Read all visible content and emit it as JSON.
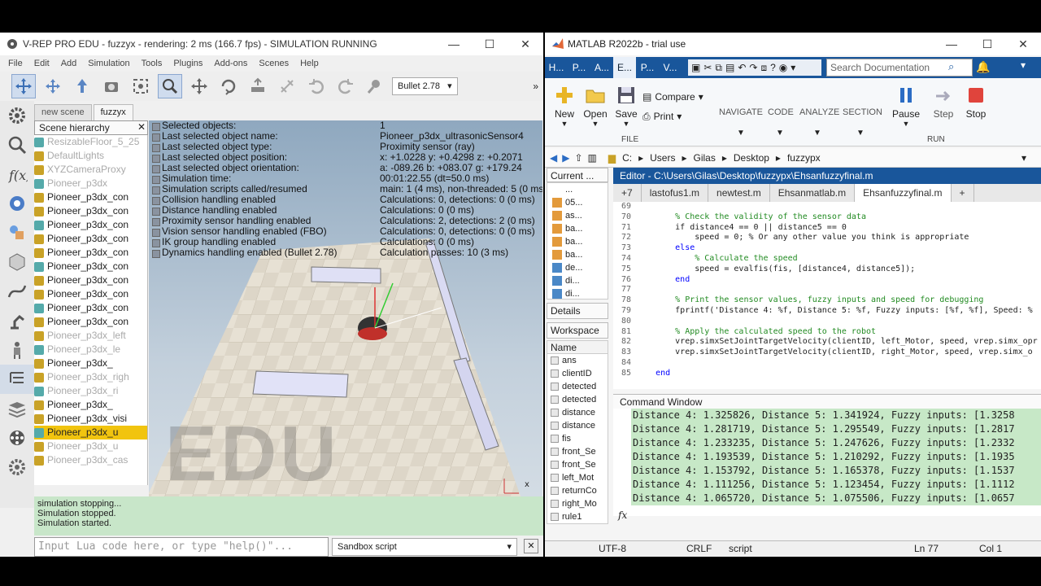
{
  "vrep": {
    "title": "V-REP PRO EDU - fuzzyx - rendering: 2 ms (166.7 fps) - SIMULATION RUNNING",
    "menu": [
      "File",
      "Edit",
      "Add",
      "Simulation",
      "Tools",
      "Plugins",
      "Add-ons",
      "Scenes",
      "Help"
    ],
    "engine": "Bullet 2.78",
    "scene_tabs": [
      "new scene",
      "fuzzyx"
    ],
    "hierarchy_title": "Scene hierarchy",
    "hierarchy": [
      {
        "label": "ResizableFloor_5_25",
        "style": "dim"
      },
      {
        "label": "DefaultLights",
        "style": "dim"
      },
      {
        "label": "XYZCameraProxy",
        "style": "dim"
      },
      {
        "label": "Pioneer_p3dx",
        "style": "dim"
      },
      {
        "label": "Pioneer_p3dx_con",
        "style": "normal"
      },
      {
        "label": "Pioneer_p3dx_con",
        "style": "normal"
      },
      {
        "label": "Pioneer_p3dx_con",
        "style": "normal"
      },
      {
        "label": "Pioneer_p3dx_con",
        "style": "normal"
      },
      {
        "label": "Pioneer_p3dx_con",
        "style": "normal"
      },
      {
        "label": "Pioneer_p3dx_con",
        "style": "normal"
      },
      {
        "label": "Pioneer_p3dx_con",
        "style": "normal"
      },
      {
        "label": "Pioneer_p3dx_con",
        "style": "normal"
      },
      {
        "label": "Pioneer_p3dx_con",
        "style": "normal"
      },
      {
        "label": "Pioneer_p3dx_con",
        "style": "normal"
      },
      {
        "label": "Pioneer_p3dx_left",
        "style": "dim"
      },
      {
        "label": "Pioneer_p3dx_le",
        "style": "dim"
      },
      {
        "label": "Pioneer_p3dx_",
        "style": "normal"
      },
      {
        "label": "Pioneer_p3dx_righ",
        "style": "dim"
      },
      {
        "label": "Pioneer_p3dx_ri",
        "style": "dim"
      },
      {
        "label": "Pioneer_p3dx_",
        "style": "normal"
      },
      {
        "label": "Pioneer_p3dx_visi",
        "style": "normal"
      },
      {
        "label": "Pioneer_p3dx_u",
        "style": "highlight"
      },
      {
        "label": "Pioneer_p3dx_u",
        "style": "dim"
      },
      {
        "label": "Pioneer_p3dx_cas",
        "style": "dim"
      }
    ],
    "info": [
      {
        "k": "Selected objects:",
        "v": "1"
      },
      {
        "k": "Last selected object name:",
        "v": "Pioneer_p3dx_ultrasonicSensor4"
      },
      {
        "k": "Last selected object type:",
        "v": "Proximity sensor (ray)"
      },
      {
        "k": "Last selected object position:",
        "v": "x: +1.0228    y: +0.4298    z: +0.2071"
      },
      {
        "k": "Last selected object orientation:",
        "v": "a: -089.26    b: +083.07    g: +179.24"
      },
      {
        "k": "Simulation time:",
        "v": "00:01:22.55 (dt=50.0 ms)"
      },
      {
        "k": "Simulation scripts called/resumed",
        "v": "main: 1 (4 ms), non-threaded: 5 (0 ms)"
      },
      {
        "k": "Collision handling enabled",
        "v": "Calculations: 0, detections: 0 (0 ms)"
      },
      {
        "k": "Distance handling enabled",
        "v": "Calculations: 0 (0 ms)"
      },
      {
        "k": "Proximity sensor handling enabled",
        "v": "Calculations: 2, detections: 2 (0 ms)"
      },
      {
        "k": "Vision sensor handling enabled (FBO)",
        "v": "Calculations: 0, detections: 0 (0 ms)"
      },
      {
        "k": "IK group handling enabled",
        "v": "Calculations: 0 (0 ms)"
      },
      {
        "k": "Dynamics handling enabled (Bullet 2.78)",
        "v": "Calculation passes: 10 (3 ms)"
      }
    ],
    "watermark": "EDU",
    "console": [
      "simulation stopping...",
      "Simulation stopped.",
      "Simulation started."
    ],
    "lua_placeholder": "Input Lua code here, or type \"help()\"...",
    "sandbox": "Sandbox script"
  },
  "matlab": {
    "title": "MATLAB R2022b - trial use",
    "tabs": [
      "H...",
      "P...",
      "A...",
      "E...",
      "P...",
      "V..."
    ],
    "search_placeholder": "Search Documentation",
    "ribbon": {
      "new": "New",
      "open": "Open",
      "save": "Save",
      "compare": "Compare",
      "print": "Print",
      "navigate": "NAVIGATE",
      "code": "CODE",
      "analyze": "ANALYZE",
      "section": "SECTION",
      "pause": "Pause",
      "step": "Step",
      "stop": "Stop",
      "file_group": "FILE",
      "run_group": "RUN"
    },
    "path": [
      "C:",
      "Users",
      "Gilas",
      "Desktop",
      "fuzzypx"
    ],
    "current_folder": "Current ...",
    "folder_items": [
      "...",
      "05...",
      "as...",
      "ba...",
      "ba...",
      "ba...",
      "de...",
      "di...",
      "di..."
    ],
    "details": "Details",
    "workspace": "Workspace",
    "ws_name_col": "Name",
    "ws_items": [
      "ans",
      "clientID",
      "detected",
      "detected",
      "distance",
      "distance",
      "fis",
      "front_Se",
      "front_Se",
      "left_Mot",
      "returnCo",
      "right_Mo",
      "rule1"
    ],
    "editor_title": "Editor - C:\\Users\\Gilas\\Desktop\\fuzzypx\\Ehsanfuzzyfinal.m",
    "editor_tabs": [
      "+7",
      "lastofus1.m",
      "newtest.m",
      "Ehsanmatlab.m",
      "Ehsanfuzzyfinal.m"
    ],
    "code": [
      {
        "n": "69",
        "t": ""
      },
      {
        "n": "70",
        "t": "        % Check the validity of the sensor data",
        "c": "cm"
      },
      {
        "n": "71",
        "t": "        if distance4 == 0 || distance5 == 0"
      },
      {
        "n": "72",
        "t": "            speed = 0; % Or any other value you think is appropriate"
      },
      {
        "n": "73",
        "t": "        else",
        "c": "kw"
      },
      {
        "n": "74",
        "t": "            % Calculate the speed",
        "c": "cm"
      },
      {
        "n": "75",
        "t": "            speed = evalfis(fis, [distance4, distance5]);"
      },
      {
        "n": "76",
        "t": "        end",
        "c": "kw"
      },
      {
        "n": "77",
        "t": ""
      },
      {
        "n": "78",
        "t": "        % Print the sensor values, fuzzy inputs and speed for debugging",
        "c": "cm"
      },
      {
        "n": "79",
        "t": "        fprintf('Distance 4: %f, Distance 5: %f, Fuzzy inputs: [%f, %f], Speed: %"
      },
      {
        "n": "80",
        "t": ""
      },
      {
        "n": "81",
        "t": "        % Apply the calculated speed to the robot",
        "c": "cm"
      },
      {
        "n": "82",
        "t": "        vrep.simxSetJointTargetVelocity(clientID, left_Motor, speed, vrep.simx_opr"
      },
      {
        "n": "83",
        "t": "        vrep.simxSetJointTargetVelocity(clientID, right_Motor, speed, vrep.simx_o"
      },
      {
        "n": "84",
        "t": ""
      },
      {
        "n": "85",
        "t": "    end",
        "c": "kw"
      }
    ],
    "command_window": "Command Window",
    "output": [
      "Distance 4: 1.325826, Distance 5: 1.341924, Fuzzy inputs: [1.3258",
      "Distance 4: 1.281719, Distance 5: 1.295549, Fuzzy inputs: [1.2817",
      "Distance 4: 1.233235, Distance 5: 1.247626, Fuzzy inputs: [1.2332",
      "Distance 4: 1.193539, Distance 5: 1.210292, Fuzzy inputs: [1.1935",
      "Distance 4: 1.153792, Distance 5: 1.165378, Fuzzy inputs: [1.1537",
      "Distance 4: 1.111256, Distance 5: 1.123454, Fuzzy inputs: [1.1112",
      "Distance 4: 1.065720, Distance 5: 1.075506, Fuzzy inputs: [1.0657"
    ],
    "fx": "fx",
    "status": {
      "enc": "UTF-8",
      "eol": "CRLF",
      "mode": "script",
      "ln": "Ln  77",
      "col": "Col  1"
    }
  }
}
